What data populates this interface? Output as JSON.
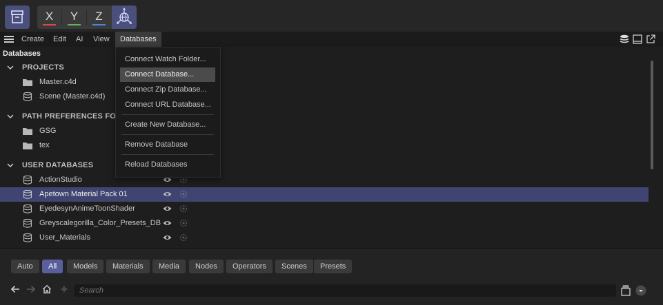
{
  "toolbar": {
    "axis_buttons": [
      {
        "label": "X",
        "color": "#d94a4a"
      },
      {
        "label": "Y",
        "color": "#5fb35f"
      },
      {
        "label": "Z",
        "color": "#4a86d9"
      }
    ],
    "icons": {
      "archive": "archive-icon",
      "world_coordinates": "world-coordinate-icon"
    }
  },
  "menu": {
    "items": [
      "Create",
      "Edit",
      "AI",
      "View",
      "Databases"
    ],
    "active": "Databases",
    "right_icons": [
      "database-stack-icon",
      "panel-icon",
      "external-link-icon"
    ]
  },
  "panel": {
    "title": "Databases"
  },
  "tree": {
    "projects": {
      "header": "PROJECTS",
      "items": [
        {
          "label": "Master.c4d",
          "icon": "folder-icon"
        },
        {
          "label": "Scene (Master.c4d)",
          "icon": "database-icon"
        }
      ]
    },
    "path_prefs": {
      "header": "PATH PREFERENCES FOLDERS",
      "items": [
        {
          "label": "GSG",
          "icon": "folder-icon"
        },
        {
          "label": "tex",
          "icon": "folder-icon"
        }
      ]
    },
    "user_dbs": {
      "header": "USER DATABASES",
      "items": [
        {
          "label": "ActionStudio",
          "icon": "database-icon"
        },
        {
          "label": "Apetown Material Pack 01",
          "icon": "database-icon",
          "selected": true
        },
        {
          "label": "EyedesynAnimeToonShader",
          "icon": "database-icon"
        },
        {
          "label": "Greyscalegorilla_Color_Presets_DB",
          "icon": "database-icon"
        },
        {
          "label": "User_Materials",
          "icon": "database-icon"
        }
      ]
    }
  },
  "dropdown": {
    "items": [
      {
        "label": "Connect Watch Folder..."
      },
      {
        "label": "Connect Database...",
        "hover": true
      },
      {
        "label": "Connect Zip Database..."
      },
      {
        "label": "Connect URL Database..."
      },
      {
        "label": "Create New Database..."
      },
      {
        "label": "Remove Database"
      },
      {
        "label": "Reload Databases"
      }
    ]
  },
  "filters": {
    "items": [
      "Auto",
      "All",
      "Models",
      "Materials",
      "Media",
      "Nodes",
      "Operators",
      "Scenes",
      "Presets"
    ],
    "active": "All"
  },
  "search": {
    "placeholder": "Search"
  },
  "colors": {
    "accent": "#5a5f9c",
    "selected_row": "#3f4470",
    "toolbar_active": "#4a4f7c"
  }
}
